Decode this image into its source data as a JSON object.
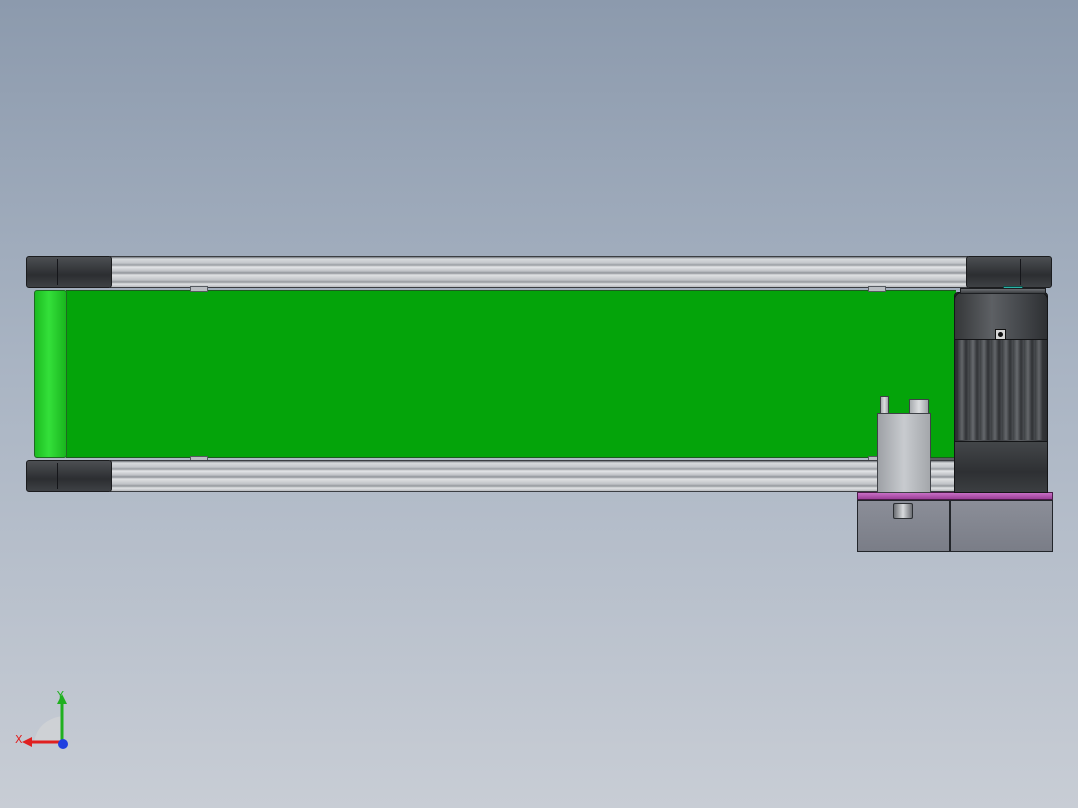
{
  "viewport": {
    "background_top": "#8c9aad",
    "background_bottom": "#c8cdd5"
  },
  "model": {
    "belt_color": "#04a40a",
    "roller_color": "#34e03a",
    "frame_color": "#c4c7cb",
    "motor_color": "#3a3c40",
    "mount_plate_color": "#b85ab4"
  },
  "triad": {
    "x_label": "X",
    "y_label": "Y",
    "x_color": "#e02020",
    "y_color": "#20b020",
    "z_color": "#2040e0"
  }
}
